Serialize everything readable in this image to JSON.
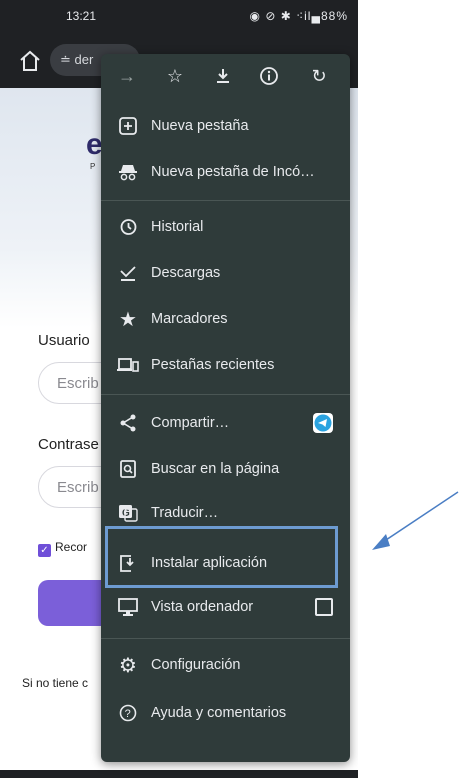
{
  "status_bar": {
    "time": "13:21",
    "icons_text": "◉ ⊘ ✱ ⁖il▄88%",
    "battery": "88%"
  },
  "toolbar": {
    "url_text": "≐ der"
  },
  "background_page": {
    "logo_letter": "e",
    "logo_sub": "P",
    "username_label": "Usuario",
    "username_placeholder": "Escrib",
    "password_label": "Contrase",
    "password_placeholder": "Escrib",
    "remember_label": "Recor",
    "signup_text": "Si no tiene c"
  },
  "menu": {
    "top_icons": [
      "forward-icon",
      "star-icon",
      "download-icon",
      "info-icon",
      "refresh-icon"
    ],
    "items": [
      {
        "label": "Nueva pestaña",
        "icon": "plus-box-icon"
      },
      {
        "label": "Nueva pestaña de Incó…",
        "icon": "incognito-icon"
      },
      {
        "label": "Historial",
        "icon": "history-icon"
      },
      {
        "label": "Descargas",
        "icon": "download-check-icon"
      },
      {
        "label": "Marcadores",
        "icon": "star-filled-icon"
      },
      {
        "label": "Pestañas recientes",
        "icon": "devices-icon"
      },
      {
        "label": "Compartir…",
        "icon": "share-icon"
      },
      {
        "label": "Buscar en la página",
        "icon": "find-in-page-icon"
      },
      {
        "label": "Traducir…",
        "icon": "translate-icon"
      },
      {
        "label": "Instalar aplicación",
        "icon": "install-app-icon"
      },
      {
        "label": "Vista ordenador",
        "icon": "desktop-icon"
      },
      {
        "label": "Configuración",
        "icon": "settings-gear-icon"
      },
      {
        "label": "Ayuda y comentarios",
        "icon": "help-icon"
      }
    ]
  },
  "colors": {
    "menu_bg": "#2f3b3a",
    "highlight": "#6d9bd1",
    "arrow": "#4a7ec4",
    "telegram": "#2aa3e0"
  }
}
